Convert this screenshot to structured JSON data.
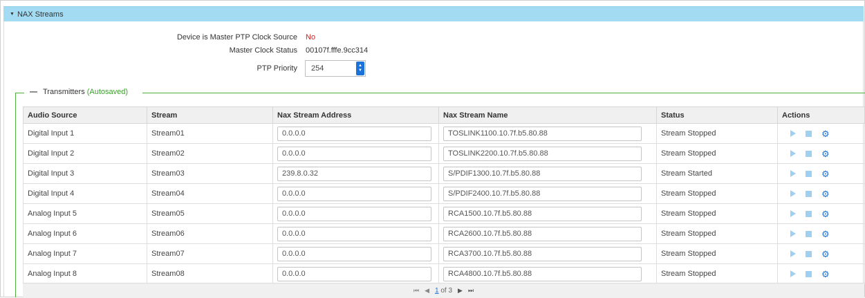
{
  "header": {
    "title": "NAX Streams"
  },
  "ptp": {
    "master_label": "Device is Master PTP Clock Source",
    "master_value": "No",
    "status_label": "Master Clock Status",
    "status_value": "00107f.fffe.9cc314",
    "priority_label": "PTP Priority",
    "priority_value": "254"
  },
  "transmitters": {
    "legend": "Transmitters",
    "autosaved": "(Autosaved)",
    "columns": [
      "Audio Source",
      "Stream",
      "Nax Stream Address",
      "Nax Stream Name",
      "Status",
      "Actions"
    ],
    "rows": [
      {
        "source": "Digital Input 1",
        "stream": "Stream01",
        "address": "0.0.0.0",
        "name": "TOSLINK1100.10.7f.b5.80.88",
        "status": "Stream Stopped"
      },
      {
        "source": "Digital Input 2",
        "stream": "Stream02",
        "address": "0.0.0.0",
        "name": "TOSLINK2200.10.7f.b5.80.88",
        "status": "Stream Stopped"
      },
      {
        "source": "Digital Input 3",
        "stream": "Stream03",
        "address": "239.8.0.32",
        "name": "S/PDIF1300.10.7f.b5.80.88",
        "status": "Stream Started"
      },
      {
        "source": "Digital Input 4",
        "stream": "Stream04",
        "address": "0.0.0.0",
        "name": "S/PDIF2400.10.7f.b5.80.88",
        "status": "Stream Stopped"
      },
      {
        "source": "Analog Input 5",
        "stream": "Stream05",
        "address": "0.0.0.0",
        "name": "RCA1500.10.7f.b5.80.88",
        "status": "Stream Stopped"
      },
      {
        "source": "Analog Input 6",
        "stream": "Stream06",
        "address": "0.0.0.0",
        "name": "RCA2600.10.7f.b5.80.88",
        "status": "Stream Stopped"
      },
      {
        "source": "Analog Input 7",
        "stream": "Stream07",
        "address": "0.0.0.0",
        "name": "RCA3700.10.7f.b5.80.88",
        "status": "Stream Stopped"
      },
      {
        "source": "Analog Input 8",
        "stream": "Stream08",
        "address": "0.0.0.0",
        "name": "RCA4800.10.7f.b5.80.88",
        "status": "Stream Stopped"
      }
    ]
  },
  "pager": {
    "current": "1",
    "of_text": "of 3"
  },
  "icons": {
    "play": "play-icon",
    "stop": "stop-icon",
    "settings": "gear-icon"
  },
  "colors": {
    "header_bg": "#a3dcf2",
    "accent": "#1a73d9",
    "no_value": "#cc2222",
    "autosaved": "#3aa02a",
    "fieldset": "#4caf3a"
  }
}
